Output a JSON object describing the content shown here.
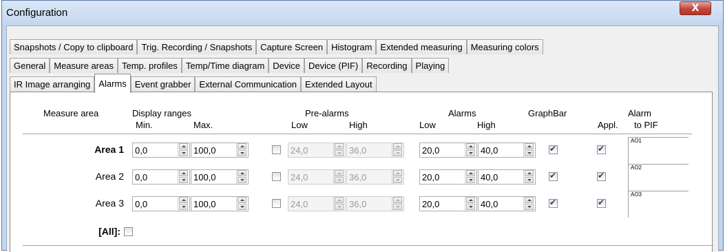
{
  "window": {
    "title": "Configuration",
    "close_label": "X"
  },
  "tabs": {
    "row1": [
      "Snapshots / Copy to clipboard",
      "Trig. Recording / Snapshots",
      "Capture Screen",
      "Histogram",
      "Extended measuring",
      "Measuring colors"
    ],
    "row2": [
      "General",
      "Measure areas",
      "Temp. profiles",
      "Temp/Time diagram",
      "Device",
      "Device (PIF)",
      "Recording",
      "Playing"
    ],
    "row3": [
      "IR Image arranging",
      "Alarms",
      "Event grabber",
      "External Communication",
      "Extended Layout"
    ],
    "active": "Alarms"
  },
  "headers": {
    "measure_area": "Measure area",
    "display_ranges": "Display ranges",
    "min": "Min.",
    "max": "Max.",
    "pre_alarms": "Pre-alarms",
    "pre_low": "Low",
    "pre_high": "High",
    "alarms": "Alarms",
    "alarm_low": "Low",
    "alarm_high": "High",
    "graphbar": "GraphBar",
    "appl": "Appl.",
    "alarm_to_pif_line1": "Alarm",
    "alarm_to_pif_line2": "to PIF"
  },
  "rows": [
    {
      "label": "Area 1",
      "bold": true,
      "min": "0,0",
      "max": "100,0",
      "pre_enabled": false,
      "pre_low": "24,0",
      "pre_high": "36,0",
      "low": "20,0",
      "high": "40,0",
      "graphbar": true,
      "appl": true,
      "pif": "AO1"
    },
    {
      "label": "Area 2",
      "bold": false,
      "min": "0,0",
      "max": "100,0",
      "pre_enabled": false,
      "pre_low": "24,0",
      "pre_high": "36,0",
      "low": "20,0",
      "high": "40,0",
      "graphbar": true,
      "appl": true,
      "pif": "AO2"
    },
    {
      "label": "Area 3",
      "bold": false,
      "min": "0,0",
      "max": "100,0",
      "pre_enabled": false,
      "pre_low": "24,0",
      "pre_high": "36,0",
      "low": "20,0",
      "high": "40,0",
      "graphbar": true,
      "appl": true,
      "pif": "AO3"
    }
  ],
  "all": {
    "label": "[All]:",
    "checked": false
  }
}
